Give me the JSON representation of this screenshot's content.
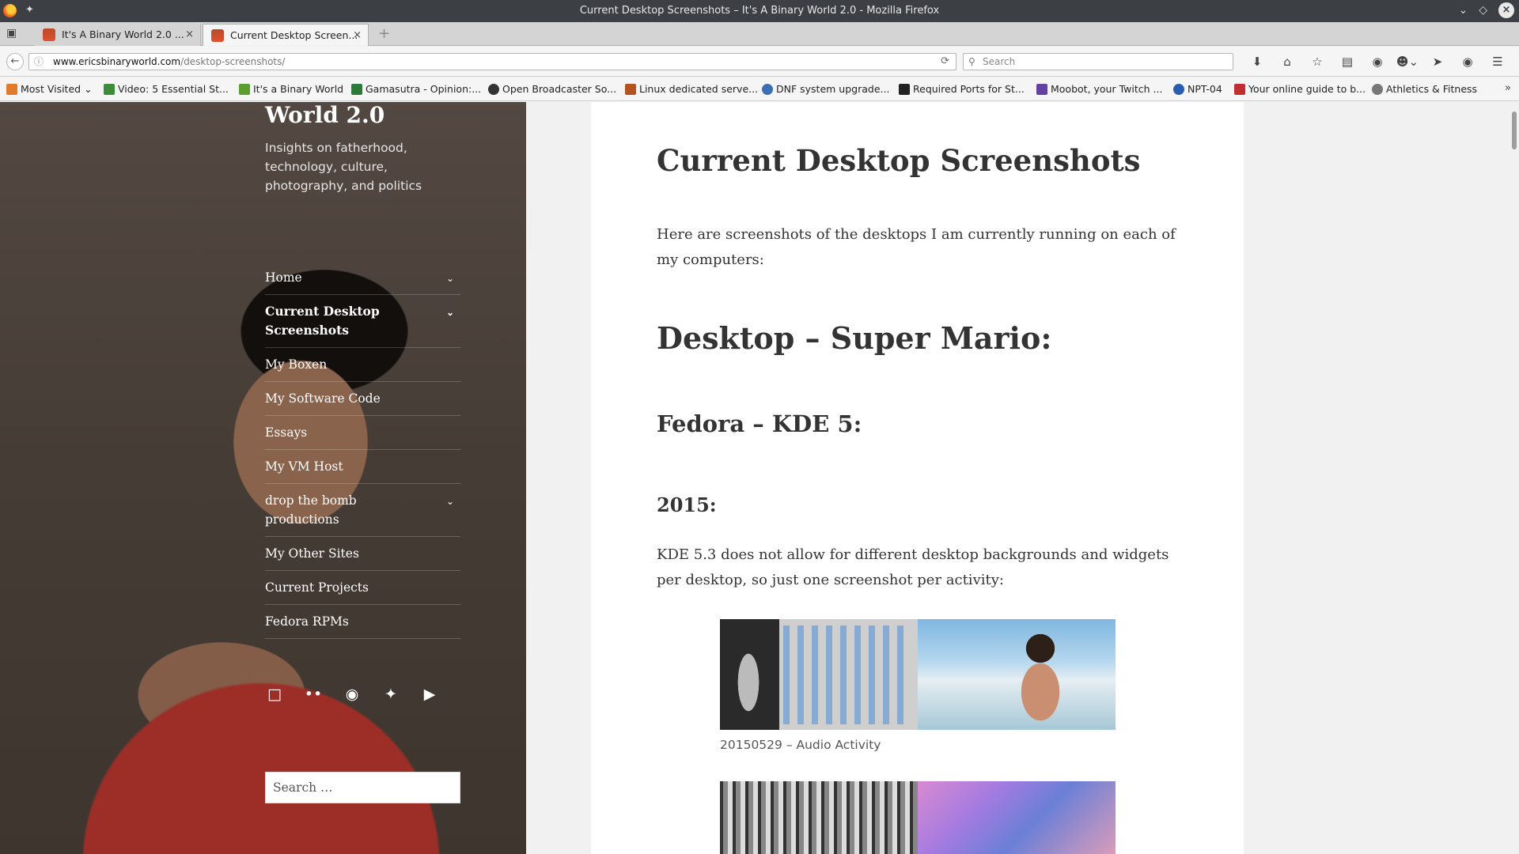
{
  "window": {
    "title": "Current Desktop Screenshots – It's A Binary World 2.0 - Mozilla Firefox"
  },
  "tabs": [
    {
      "label": "It's A Binary World 2.0 ...",
      "active": false
    },
    {
      "label": "Current Desktop Screen...",
      "active": true
    }
  ],
  "nav": {
    "url_domain": "www.ericsbinaryworld.com",
    "url_path": "/desktop-screenshots/",
    "search_placeholder": "Search"
  },
  "bookmarks": [
    {
      "label": "Most Visited",
      "color": "#e07b2b"
    },
    {
      "label": "Video: 5 Essential St...",
      "color": "#3c8c3c"
    },
    {
      "label": "It's a Binary World",
      "color": "#5a9e2f"
    },
    {
      "label": "Gamasutra - Opinion:...",
      "color": "#2b7a3a"
    },
    {
      "label": "Open Broadcaster So...",
      "color": "#333333"
    },
    {
      "label": "Linux dedicated serve...",
      "color": "#b3541e"
    },
    {
      "label": "DNF system upgrade...",
      "color": "#3c6eb4"
    },
    {
      "label": "Required Ports for St...",
      "color": "#222222"
    },
    {
      "label": "Moobot, your Twitch ...",
      "color": "#6441a5"
    },
    {
      "label": "NPT-04",
      "color": "#2a5db0"
    },
    {
      "label": "Your online guide to b...",
      "color": "#c03030"
    },
    {
      "label": "Athletics & Fitness",
      "color": "#777777"
    }
  ],
  "sidebar": {
    "site_title": "World 2.0",
    "site_description": "Insights on fatherhood, technology, culture, photography, and politics",
    "menu": [
      {
        "label": "Home",
        "has_children": true
      },
      {
        "label": "Current Desktop Screenshots",
        "has_children": true,
        "current": true
      },
      {
        "label": "My Boxen",
        "has_children": false
      },
      {
        "label": "My Software Code",
        "has_children": false
      },
      {
        "label": "Essays",
        "has_children": false
      },
      {
        "label": "My VM Host",
        "has_children": false
      },
      {
        "label": "drop the bomb productions",
        "has_children": true
      },
      {
        "label": "My Other Sites",
        "has_children": false
      },
      {
        "label": "Current Projects",
        "has_children": false
      },
      {
        "label": "Fedora RPMs",
        "has_children": false
      }
    ],
    "social": [
      "twitch-icon",
      "flickr-icon",
      "github-icon",
      "twitter-icon",
      "youtube-icon"
    ],
    "search_placeholder": "Search …"
  },
  "content": {
    "title": "Current Desktop Screenshots",
    "intro": "Here are screenshots of the desktops I am currently running on each of my computers:",
    "section1": "Desktop – Super Mario:",
    "section2": "Fedora – KDE 5:",
    "section3": "2015:",
    "paragraph": "KDE 5.3 does not allow for different desktop backgrounds and widgets per desktop, so just one screenshot per activity:",
    "caption1": "20150529 – Audio Activity"
  }
}
